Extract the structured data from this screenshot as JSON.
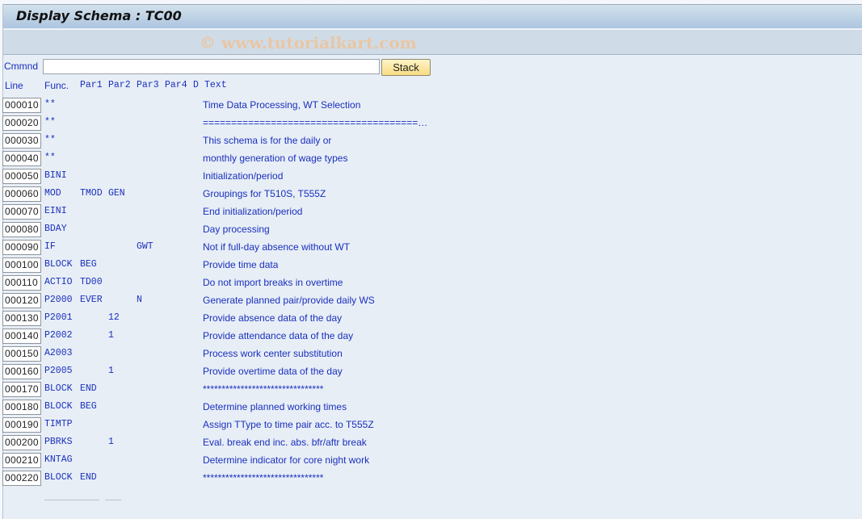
{
  "window": {
    "title": "Display Schema : TC00",
    "watermark": "© www.tutorialkart.com"
  },
  "command": {
    "label": "Cmmnd",
    "value": "",
    "placeholder": "",
    "stack_button": "Stack"
  },
  "columns": {
    "line": "Line",
    "func": "Func.",
    "par1": "Par1",
    "par2": "Par2",
    "par3": "Par3",
    "par4": "Par4",
    "d": "D",
    "text": "Text"
  },
  "rows": [
    {
      "line": "000010",
      "func": "**",
      "par1": "",
      "par2": "",
      "par3": "",
      "par4": "",
      "d": "",
      "text": "Time Data Processing, WT Selection"
    },
    {
      "line": "000020",
      "func": "**",
      "par1": "",
      "par2": "",
      "par3": "",
      "par4": "",
      "d": "",
      "text": "=============================================="
    },
    {
      "line": "000030",
      "func": "**",
      "par1": "",
      "par2": "",
      "par3": "",
      "par4": "",
      "d": "",
      "text": "This schema is for the daily or"
    },
    {
      "line": "000040",
      "func": "**",
      "par1": "",
      "par2": "",
      "par3": "",
      "par4": "",
      "d": "",
      "text": "monthly generation of wage types"
    },
    {
      "line": "000050",
      "func": "BINI",
      "par1": "",
      "par2": "",
      "par3": "",
      "par4": "",
      "d": "",
      "text": "Initialization/period"
    },
    {
      "line": "000060",
      "func": "MOD",
      "par1": "TMOD",
      "par2": "GEN",
      "par3": "",
      "par4": "",
      "d": "",
      "text": "Groupings for T510S, T555Z"
    },
    {
      "line": "000070",
      "func": "EINI",
      "par1": "",
      "par2": "",
      "par3": "",
      "par4": "",
      "d": "",
      "text": "End initialization/period"
    },
    {
      "line": "000080",
      "func": "BDAY",
      "par1": "",
      "par2": "",
      "par3": "",
      "par4": "",
      "d": "",
      "text": "Day processing"
    },
    {
      "line": "000090",
      "func": "IF",
      "par1": "",
      "par2": "",
      "par3": "GWT",
      "par4": "",
      "d": "",
      "text": "Not if full-day absence without WT"
    },
    {
      "line": "000100",
      "func": "BLOCK",
      "par1": "BEG",
      "par2": "",
      "par3": "",
      "par4": "",
      "d": "",
      "text": "Provide time data"
    },
    {
      "line": "000110",
      "func": "ACTIO",
      "par1": "TD00",
      "par2": "",
      "par3": "",
      "par4": "",
      "d": "",
      "text": "Do not import breaks in overtime"
    },
    {
      "line": "000120",
      "func": "P2000",
      "par1": "EVER",
      "par2": "",
      "par3": "N",
      "par4": "",
      "d": "",
      "text": "Generate planned pair/provide daily WS"
    },
    {
      "line": "000130",
      "func": "P2001",
      "par1": "",
      "par2": "12",
      "par3": "",
      "par4": "",
      "d": "",
      "text": "Provide absence data of the day"
    },
    {
      "line": "000140",
      "func": "P2002",
      "par1": "",
      "par2": "1",
      "par3": "",
      "par4": "",
      "d": "",
      "text": "Provide attendance data of the day"
    },
    {
      "line": "000150",
      "func": "A2003",
      "par1": "",
      "par2": "",
      "par3": "",
      "par4": "",
      "d": "",
      "text": "Process work center substitution"
    },
    {
      "line": "000160",
      "func": "P2005",
      "par1": "",
      "par2": "1",
      "par3": "",
      "par4": "",
      "d": "",
      "text": "Provide overtime data of the day"
    },
    {
      "line": "000170",
      "func": "BLOCK",
      "par1": "END",
      "par2": "",
      "par3": "",
      "par4": "",
      "d": "",
      "text": "********************************"
    },
    {
      "line": "000180",
      "func": "BLOCK",
      "par1": "BEG",
      "par2": "",
      "par3": "",
      "par4": "",
      "d": "",
      "text": "Determine planned working times"
    },
    {
      "line": "000190",
      "func": "TIMTP",
      "par1": "",
      "par2": "",
      "par3": "",
      "par4": "",
      "d": "",
      "text": "Assign TType to time pair acc. to T555Z"
    },
    {
      "line": "000200",
      "func": "PBRKS",
      "par1": "",
      "par2": "1",
      "par3": "",
      "par4": "",
      "d": "",
      "text": "Eval. break end inc. abs. bfr/aftr break"
    },
    {
      "line": "000210",
      "func": "KNTAG",
      "par1": "",
      "par2": "",
      "par3": "",
      "par4": "",
      "d": "",
      "text": "Determine indicator for core night work"
    },
    {
      "line": "000220",
      "func": "BLOCK",
      "par1": "END",
      "par2": "",
      "par3": "",
      "par4": "",
      "d": "",
      "text": "********************************"
    }
  ]
}
